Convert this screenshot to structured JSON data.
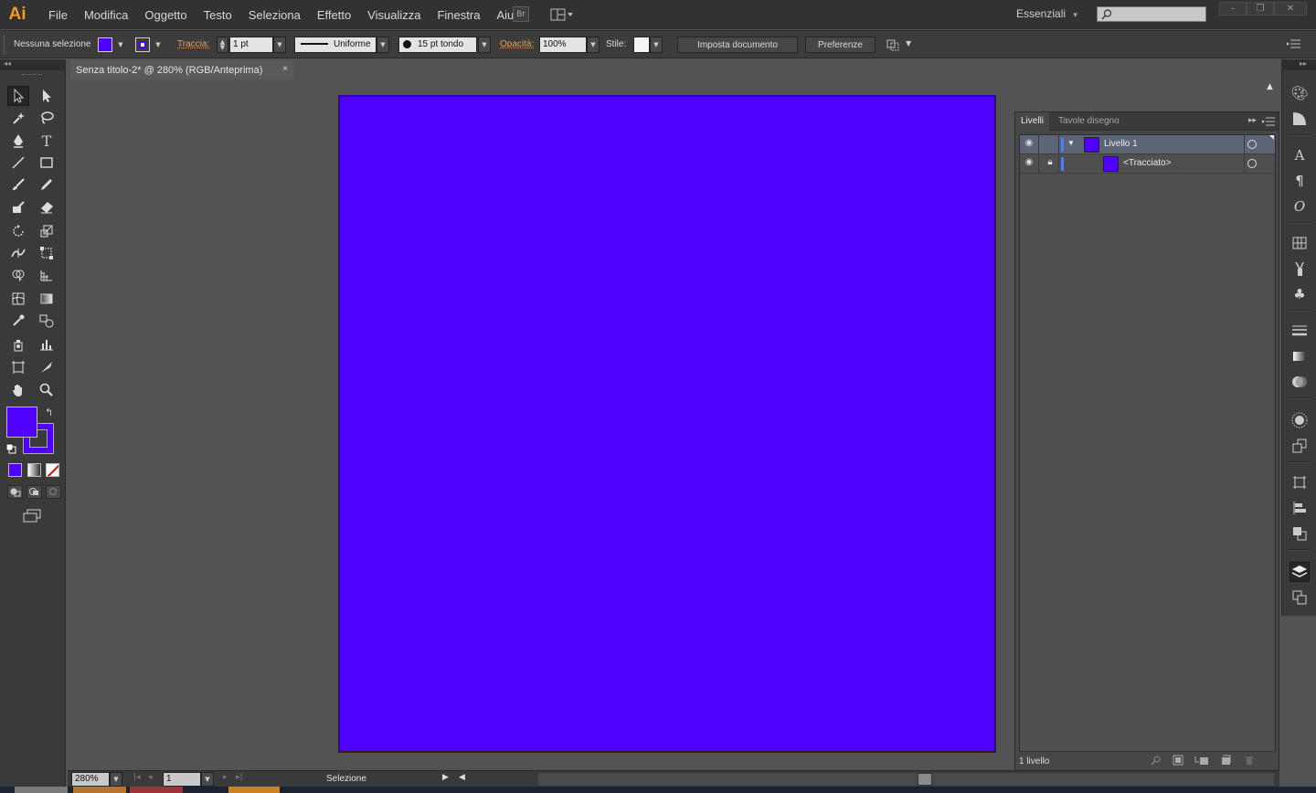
{
  "app": {
    "logo": "Ai"
  },
  "menu": [
    "File",
    "Modifica",
    "Oggetto",
    "Testo",
    "Seleziona",
    "Effetto",
    "Visualizza",
    "Finestra",
    "Aiuto"
  ],
  "menubar": {
    "bridge_label": "Br",
    "workspace": "Essenziali",
    "workspace_arrow": "▾",
    "search_icon": "search-icon"
  },
  "window_controls": {
    "minimize": "–",
    "restore": "❐",
    "close": "✕"
  },
  "control_bar": {
    "selection_status": "Nessuna selezione",
    "fill_color": "#5000ff",
    "stroke_color": "#5000ff",
    "stroke_label": "Traccia:",
    "stroke_weight": "1 pt",
    "stroke_profile": "Uniforme",
    "brush": "15 pt tondo",
    "opacity_label": "Opacità:",
    "opacity_value": "100%",
    "style_label": "Stile:",
    "document_setup": "Imposta documento",
    "preferences": "Preferenze"
  },
  "document": {
    "tab_title": "Senza titolo-2* @ 280% (RGB/Anteprima)",
    "tab_close": "×",
    "artboard_fill": "#5000ff"
  },
  "layers_panel": {
    "tabs": [
      "Livelli",
      "Tavole disegno"
    ],
    "rows": [
      {
        "name": "Livello 1",
        "expanded": true
      },
      {
        "name": "<Tracciato>"
      }
    ],
    "footer": "1 livello"
  },
  "statusbar": {
    "zoom": "280%",
    "artboard_number": "1",
    "current_tool": "Selezione"
  },
  "toolbox": {
    "fill_color": "#5000ff",
    "stroke_color": "#5000ff"
  }
}
